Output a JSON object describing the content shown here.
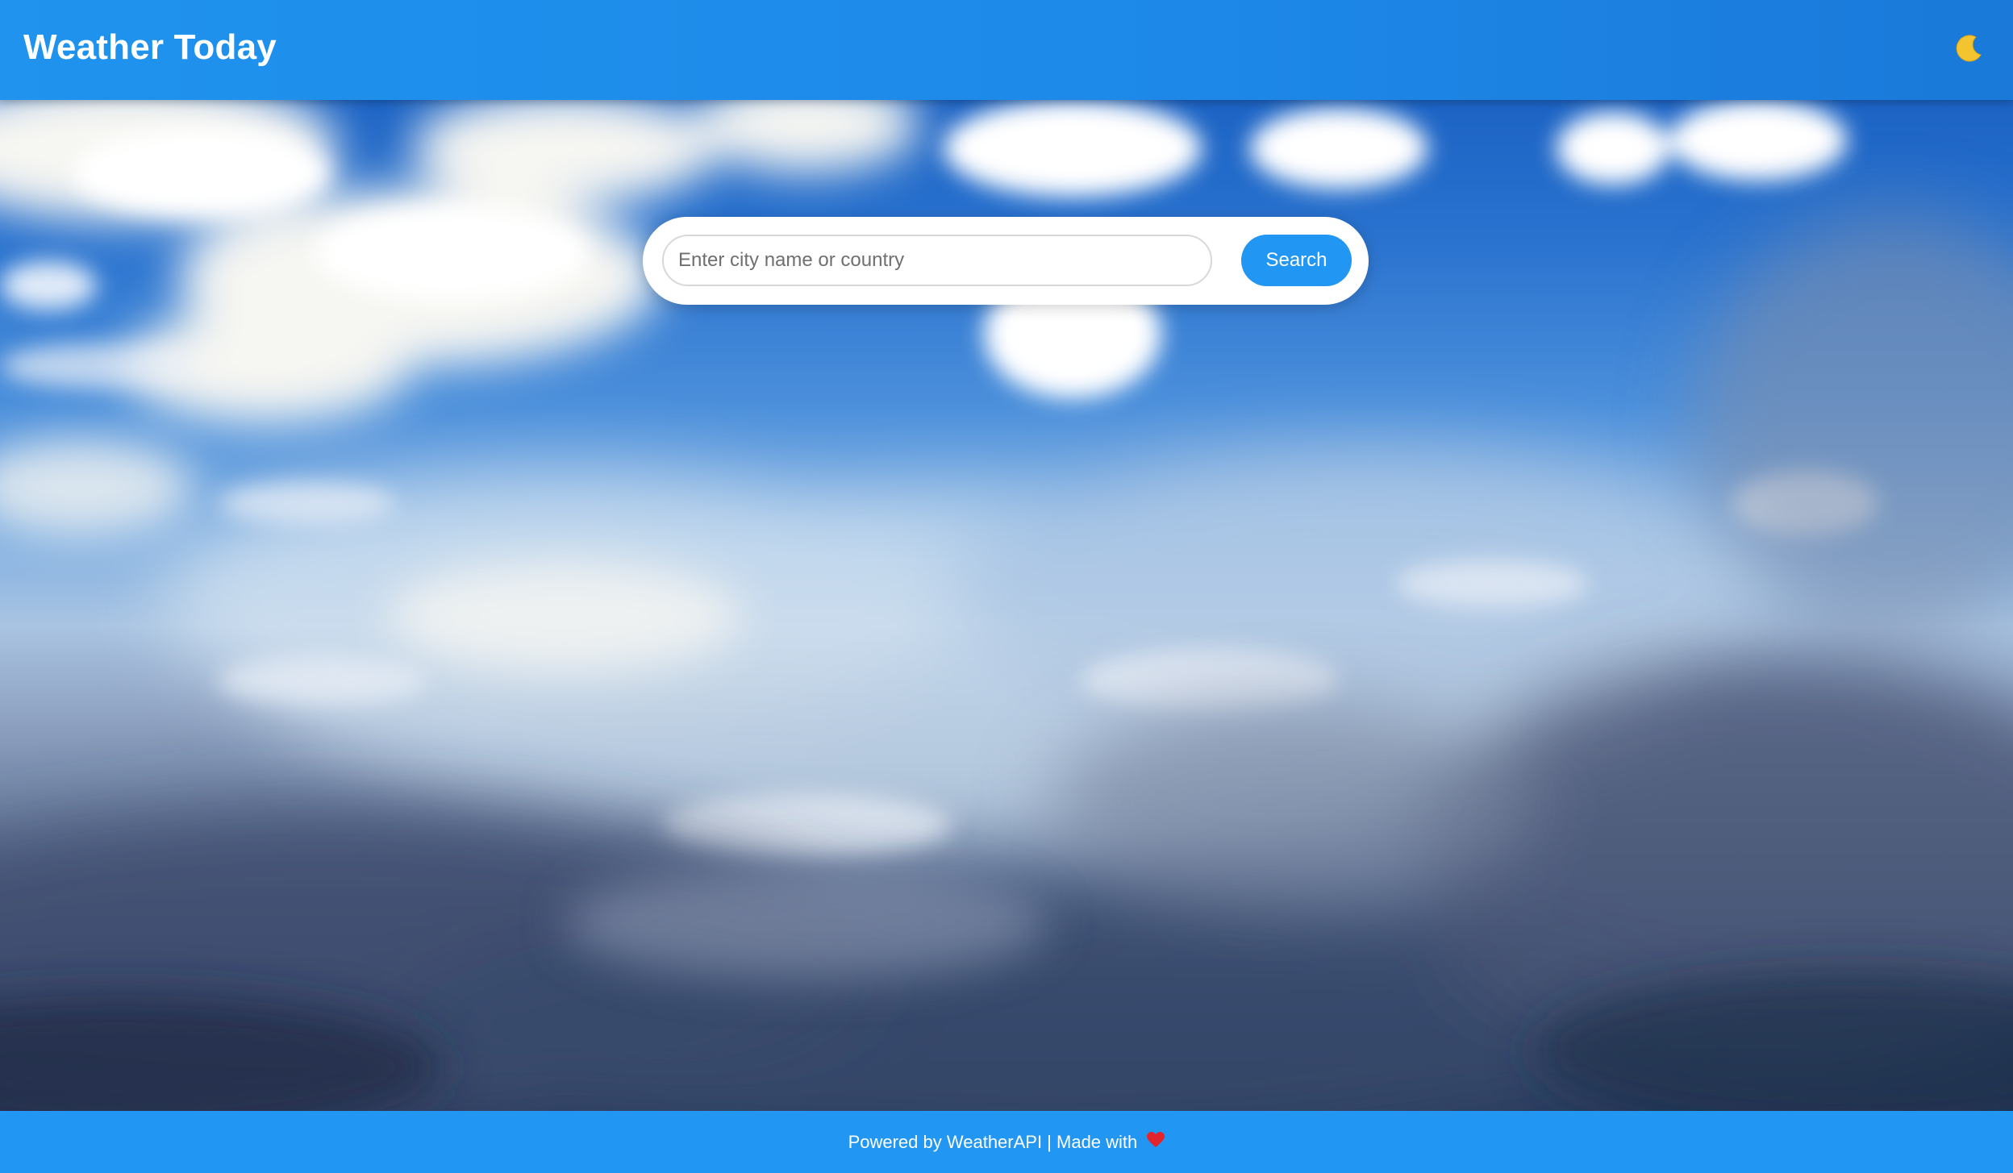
{
  "header": {
    "title": "Weather Today",
    "theme_icon": "moon-icon"
  },
  "search": {
    "placeholder": "Enter city name or country",
    "value": "",
    "button_label": "Search"
  },
  "footer": {
    "text": "Powered by WeatherAPI | Made with",
    "heart_icon": "heart-icon"
  },
  "colors": {
    "primary": "#2196f3",
    "header_gradient_start": "#1f93ee",
    "header_gradient_end": "#1a79d9",
    "moon": "#f4c430",
    "heart": "#e3242b"
  }
}
